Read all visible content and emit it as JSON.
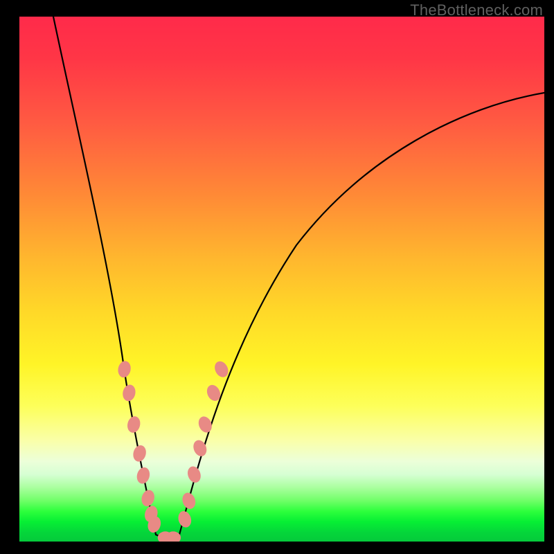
{
  "watermark": "TheBottleneck.com",
  "colors": {
    "bead": "#e88a85",
    "curve": "#000000",
    "background_top": "#ff2a4a",
    "background_bottom": "#05c83b",
    "frame": "#000000"
  },
  "chart_data": {
    "type": "line",
    "title": "",
    "xlabel": "",
    "ylabel": "",
    "xlim": [
      0,
      100
    ],
    "ylim": [
      0,
      100
    ],
    "legend": false,
    "grid": false,
    "notes": "V-shaped compatibility / bottleneck curve on a red-yellow-green gradient background. No axis ticks or numeric labels are rendered in the image; x and y values below are inferred from pixel positions on a 0–100 normalized scale.",
    "series": [
      {
        "name": "left-branch",
        "x": [
          6.5,
          10,
          14,
          17,
          18.5,
          20,
          21,
          22,
          23,
          23.8,
          24.7,
          25.5,
          26.3
        ],
        "y": [
          100,
          80,
          60,
          43,
          35,
          27,
          22,
          17,
          12.5,
          9,
          5.5,
          3,
          1.2
        ]
      },
      {
        "name": "right-branch",
        "x": [
          30.5,
          31.5,
          32.5,
          33.8,
          35,
          36.5,
          39,
          44,
          53,
          66,
          80,
          92,
          100
        ],
        "y": [
          1.2,
          3.5,
          7,
          12,
          17,
          22,
          30,
          42,
          57,
          70,
          78,
          83,
          85.5
        ]
      },
      {
        "name": "valley-floor",
        "x": [
          26.3,
          27,
          28,
          29,
          30,
          30.5
        ],
        "y": [
          1.2,
          0.9,
          0.8,
          0.8,
          0.9,
          1.2
        ]
      }
    ],
    "markers": {
      "name": "beads",
      "note": "Salmon-colored elliptical markers overlaid on lower portion of both branches and across the valley floor.",
      "points": [
        {
          "x": 20.0,
          "y": 33.0,
          "branch": "left"
        },
        {
          "x": 20.9,
          "y": 28.5,
          "branch": "left"
        },
        {
          "x": 21.8,
          "y": 22.5,
          "branch": "left"
        },
        {
          "x": 22.9,
          "y": 17.0,
          "branch": "left"
        },
        {
          "x": 23.6,
          "y": 12.8,
          "branch": "left"
        },
        {
          "x": 24.5,
          "y": 8.5,
          "branch": "left"
        },
        {
          "x": 25.1,
          "y": 5.5,
          "branch": "left"
        },
        {
          "x": 25.7,
          "y": 3.5,
          "branch": "left"
        },
        {
          "x": 27.8,
          "y": 1.0,
          "branch": "floor"
        },
        {
          "x": 29.3,
          "y": 1.0,
          "branch": "floor"
        },
        {
          "x": 31.5,
          "y": 4.5,
          "branch": "right"
        },
        {
          "x": 32.3,
          "y": 8.0,
          "branch": "right"
        },
        {
          "x": 33.3,
          "y": 13.0,
          "branch": "right"
        },
        {
          "x": 34.4,
          "y": 18.0,
          "branch": "right"
        },
        {
          "x": 35.4,
          "y": 22.5,
          "branch": "right"
        },
        {
          "x": 37.0,
          "y": 28.5,
          "branch": "right"
        },
        {
          "x": 38.5,
          "y": 33.0,
          "branch": "right"
        }
      ]
    }
  }
}
